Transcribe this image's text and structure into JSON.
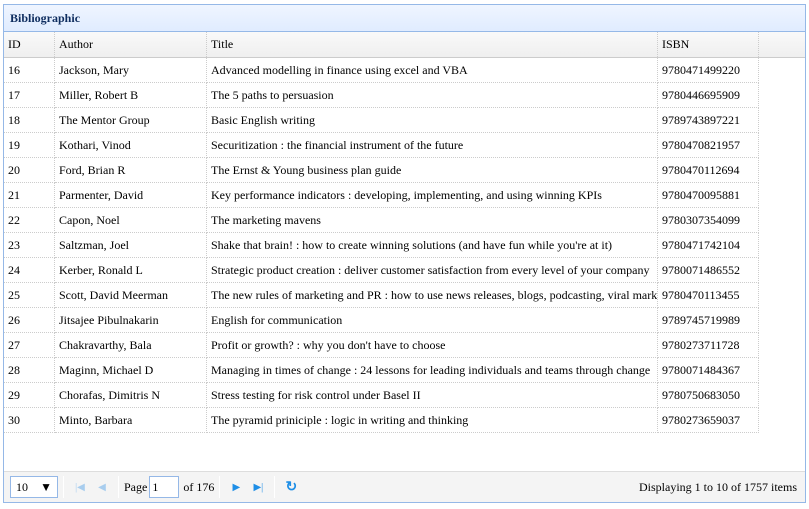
{
  "panel": {
    "title": "Bibliographic"
  },
  "columns": [
    "ID",
    "Author",
    "Title",
    "ISBN"
  ],
  "rows": [
    [
      "16",
      "Jackson, Mary",
      "Advanced modelling in finance using excel and VBA",
      "9780471499220"
    ],
    [
      "17",
      "Miller, Robert B",
      "The 5 paths to persuasion",
      "9780446695909"
    ],
    [
      "18",
      "The Mentor Group",
      "Basic English writing",
      "9789743897221"
    ],
    [
      "19",
      "Kothari, Vinod",
      "Securitization : the financial instrument of the future",
      "9780470821957"
    ],
    [
      "20",
      "Ford, Brian R",
      "The Ernst & Young business plan guide",
      "9780470112694"
    ],
    [
      "21",
      "Parmenter, David",
      "Key performance indicators : developing, implementing, and using winning KPIs",
      "9780470095881"
    ],
    [
      "22",
      "Capon, Noel",
      "The marketing mavens",
      "9780307354099"
    ],
    [
      "23",
      "Saltzman, Joel",
      "Shake that brain! : how to create winning solutions (and have fun while you're at it)",
      "9780471742104"
    ],
    [
      "24",
      "Kerber, Ronald L",
      "Strategic product creation : deliver customer satisfaction from every level of your company",
      "9780071486552"
    ],
    [
      "25",
      "Scott, David Meerman",
      "The new rules of marketing and PR : how to use news releases, blogs, podcasting, viral marke",
      "9780470113455"
    ],
    [
      "26",
      "Jitsajee Pibulnakarin",
      "English for communication",
      "9789745719989"
    ],
    [
      "27",
      "Chakravarthy, Bala",
      "Profit or growth? : why you don't have to choose",
      "9780273711728"
    ],
    [
      "28",
      "Maginn, Michael D",
      "Managing in times of change : 24 lessons for leading individuals and teams through change",
      "9780071484367"
    ],
    [
      "29",
      "Chorafas, Dimitris N",
      "Stress testing for risk control under Basel II",
      "9780750683050"
    ],
    [
      "30",
      "Minto, Barbara",
      "The pyramid priniciple : logic in writing and thinking",
      "9780273659037"
    ]
  ],
  "pager": {
    "page_size": "10",
    "page_label": "Page",
    "page": "1",
    "of_label": "of 176",
    "display": "Displaying 1 to 10 of 1757 items"
  },
  "icons": {
    "first": "first-page-icon",
    "prev": "prev-page-icon",
    "next": "next-page-icon",
    "last": "last-page-icon",
    "refresh": "refresh-icon"
  }
}
